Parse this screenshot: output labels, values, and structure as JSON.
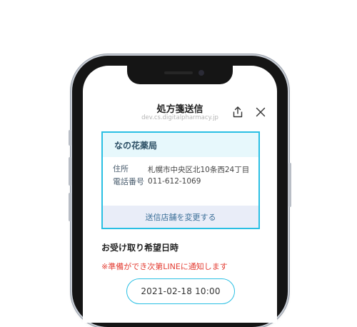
{
  "header": {
    "title": "処方箋送信",
    "url": "dev.cs.digitalpharmacy.jp",
    "share_icon": "share-icon",
    "close_icon": "close-icon"
  },
  "pharmacy_card": {
    "name": "なの花薬局",
    "address_label": "住所",
    "address_value": "札幌市中央区北10条西24丁目",
    "phone_label": "電話番号",
    "phone_value": "011-612-1069",
    "change_store_label": "送信店舗を変更する"
  },
  "pickup": {
    "section_title": "お受け取り希望日時",
    "notice": "※準備ができ次第LINEに通知します",
    "datetime": "2021-02-18 10:00"
  },
  "colors": {
    "accent": "#29bfe3",
    "notice": "#e33c32",
    "card_header_bg": "#e7f8fc",
    "card_footer_bg": "#e9edf8"
  }
}
